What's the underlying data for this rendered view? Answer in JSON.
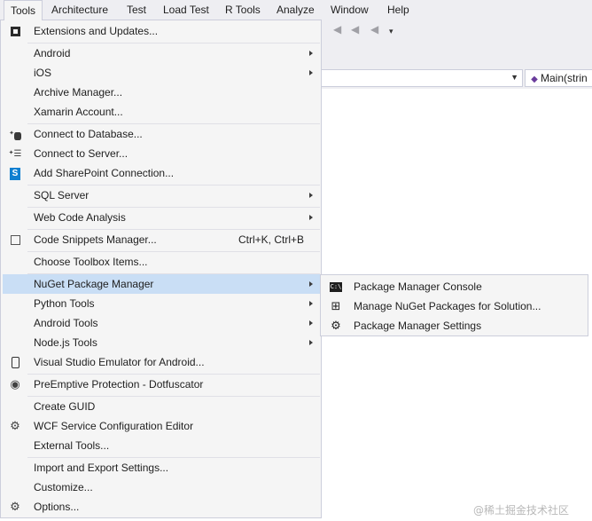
{
  "menubar": {
    "items": [
      "Tools",
      "Architecture",
      "Test",
      "Load Test",
      "R Tools",
      "Analyze",
      "Window",
      "Help"
    ]
  },
  "navbar": {
    "member_combo": "Main(strin"
  },
  "tools_menu": {
    "items": [
      {
        "label": "Extensions and Updates...",
        "icon": "extensions-icon"
      },
      {
        "label": "Android",
        "submenu": true
      },
      {
        "label": "iOS",
        "submenu": true
      },
      {
        "label": "Archive Manager..."
      },
      {
        "label": "Xamarin Account..."
      },
      {
        "label": "Connect to Database...",
        "icon": "connect-database-icon"
      },
      {
        "label": "Connect to Server...",
        "icon": "connect-server-icon"
      },
      {
        "label": "Add SharePoint Connection...",
        "icon": "sharepoint-icon"
      },
      {
        "label": "SQL Server",
        "submenu": true
      },
      {
        "label": "Web Code Analysis",
        "submenu": true
      },
      {
        "label": "Code Snippets Manager...",
        "shortcut": "Ctrl+K, Ctrl+B",
        "icon": "snippets-icon"
      },
      {
        "label": "Choose Toolbox Items..."
      },
      {
        "label": "NuGet Package Manager",
        "submenu": true,
        "highlighted": true
      },
      {
        "label": "Python Tools",
        "submenu": true
      },
      {
        "label": "Android Tools",
        "submenu": true
      },
      {
        "label": "Node.js Tools",
        "submenu": true
      },
      {
        "label": "Visual Studio Emulator for Android...",
        "icon": "phone-icon"
      },
      {
        "label": "PreEmptive Protection - Dotfuscator",
        "icon": "dotfuscator-icon"
      },
      {
        "label": "Create GUID"
      },
      {
        "label": "WCF Service Configuration Editor",
        "icon": "wcf-gear-icon"
      },
      {
        "label": "External Tools..."
      },
      {
        "label": "Import and Export Settings..."
      },
      {
        "label": "Customize..."
      },
      {
        "label": "Options...",
        "icon": "options-gear-icon"
      }
    ]
  },
  "nuget_submenu": {
    "items": [
      {
        "label": "Package Manager Console",
        "icon": "console-icon",
        "icon_text": "C:\\"
      },
      {
        "label": "Manage NuGet Packages for Solution...",
        "icon": "packages-icon"
      },
      {
        "label": "Package Manager Settings",
        "icon": "settings-gear-icon"
      }
    ]
  },
  "watermark": "@稀土掘金技术社区",
  "colors": {
    "menu_background": "#f5f5f5",
    "menubar_background": "#eeeef2",
    "highlight": "#c9def5",
    "border": "#cccedb"
  }
}
